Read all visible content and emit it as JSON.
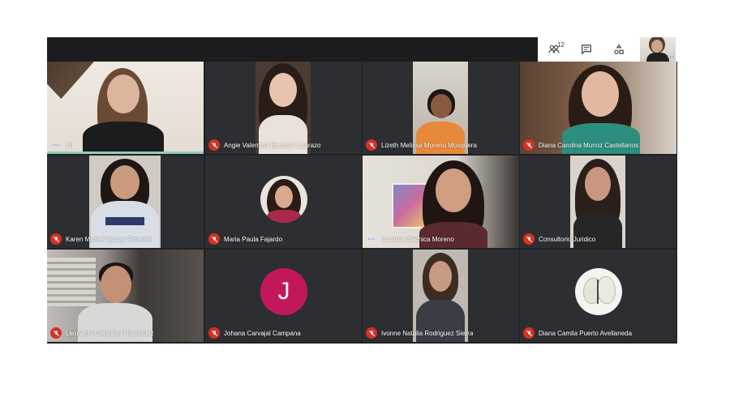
{
  "toolbar": {
    "people_count": "12"
  },
  "tiles": [
    {
      "name": "Tú",
      "status": "speaking"
    },
    {
      "name": "Angie Valentina Escobar Lizarazo",
      "status": "muted"
    },
    {
      "name": "Lizeth Melissa Moreno Mosquera",
      "status": "muted"
    },
    {
      "name": "Diana Carolina Munoz Castellanos",
      "status": "muted"
    },
    {
      "name": "Karen Michel Vargas Pimentel",
      "status": "muted"
    },
    {
      "name": "Maria Paula Fajardo",
      "status": "muted"
    },
    {
      "name": "Carolina Sachica Moreno",
      "status": "speaking"
    },
    {
      "name": "Consultorio Juridico",
      "status": "muted"
    },
    {
      "name": "Leonardo Gonzalez Rodriguez",
      "status": "muted"
    },
    {
      "name": "Johana Carvajal Campana",
      "status": "muted",
      "initial": "J"
    },
    {
      "name": "Ivonne Natalia Rodriguez Sierra",
      "status": "muted"
    },
    {
      "name": "Diana Camila Puerto Avellaneda",
      "status": "muted"
    }
  ],
  "colors": {
    "background": "#202124",
    "muted_icon": "#d93025",
    "speaking_indicator": "#8ab4f8",
    "avatar": "#c2185b"
  }
}
